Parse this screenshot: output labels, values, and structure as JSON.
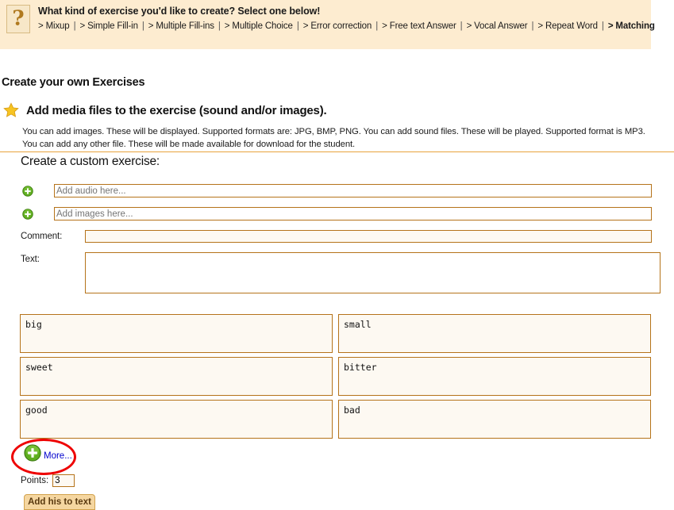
{
  "banner": {
    "icon": "question-mark-icon",
    "title": "What kind of exercise you'd like to create? Select one below!",
    "breadcrumb": [
      {
        "label": "Mixup",
        "active": false
      },
      {
        "label": "Simple Fill-in",
        "active": false
      },
      {
        "label": "Multiple Fill-ins",
        "active": false
      },
      {
        "label": "Multiple Choice",
        "active": false
      },
      {
        "label": "Error correction",
        "active": false
      },
      {
        "label": "Free text Answer",
        "active": false
      },
      {
        "label": "Vocal Answer",
        "active": false
      },
      {
        "label": "Repeat Word",
        "active": false
      },
      {
        "label": "Matching",
        "active": true
      }
    ],
    "prefix": ">",
    "separator": "|"
  },
  "page": {
    "title": "Create your own Exercises",
    "section_icon": "star-icon",
    "section_heading": "Add media files to the exercise (sound and/or images).",
    "description": "You can add images. These will be displayed. Supported formats are: JPG, BMP, PNG. You can add sound files. These will be played. Supported format is MP3. You can add any other file. These will be made available for download for the student.",
    "subsection_title": "Create a custom exercise:"
  },
  "media": {
    "audio": {
      "icon": "plus-circle-icon",
      "placeholder": "Add audio here...",
      "value": ""
    },
    "images": {
      "icon": "plus-circle-icon",
      "placeholder": "Add images here...",
      "value": ""
    }
  },
  "fields": {
    "comment_label": "Comment:",
    "comment_value": "",
    "text_label": "Text:",
    "text_value": ""
  },
  "pairs": [
    {
      "left": "big",
      "right": "small"
    },
    {
      "left": "sweet",
      "right": "bitter"
    },
    {
      "left": "good",
      "right": "bad"
    }
  ],
  "footer": {
    "more_icon": "plus-circle-icon",
    "more_label": "More...",
    "points_label": "Points:",
    "points_value": "3",
    "submit_label": "Add his to text"
  },
  "colors": {
    "banner_bg": "#fdecd0",
    "border_orange": "#b5731a",
    "rule_orange": "#e8a33d",
    "field_bg": "#fdf9f2",
    "link_blue": "#0000cc",
    "highlight_red": "#ee0000",
    "star_gold": "#f5c219",
    "plus_green": "#5aaa1e"
  }
}
